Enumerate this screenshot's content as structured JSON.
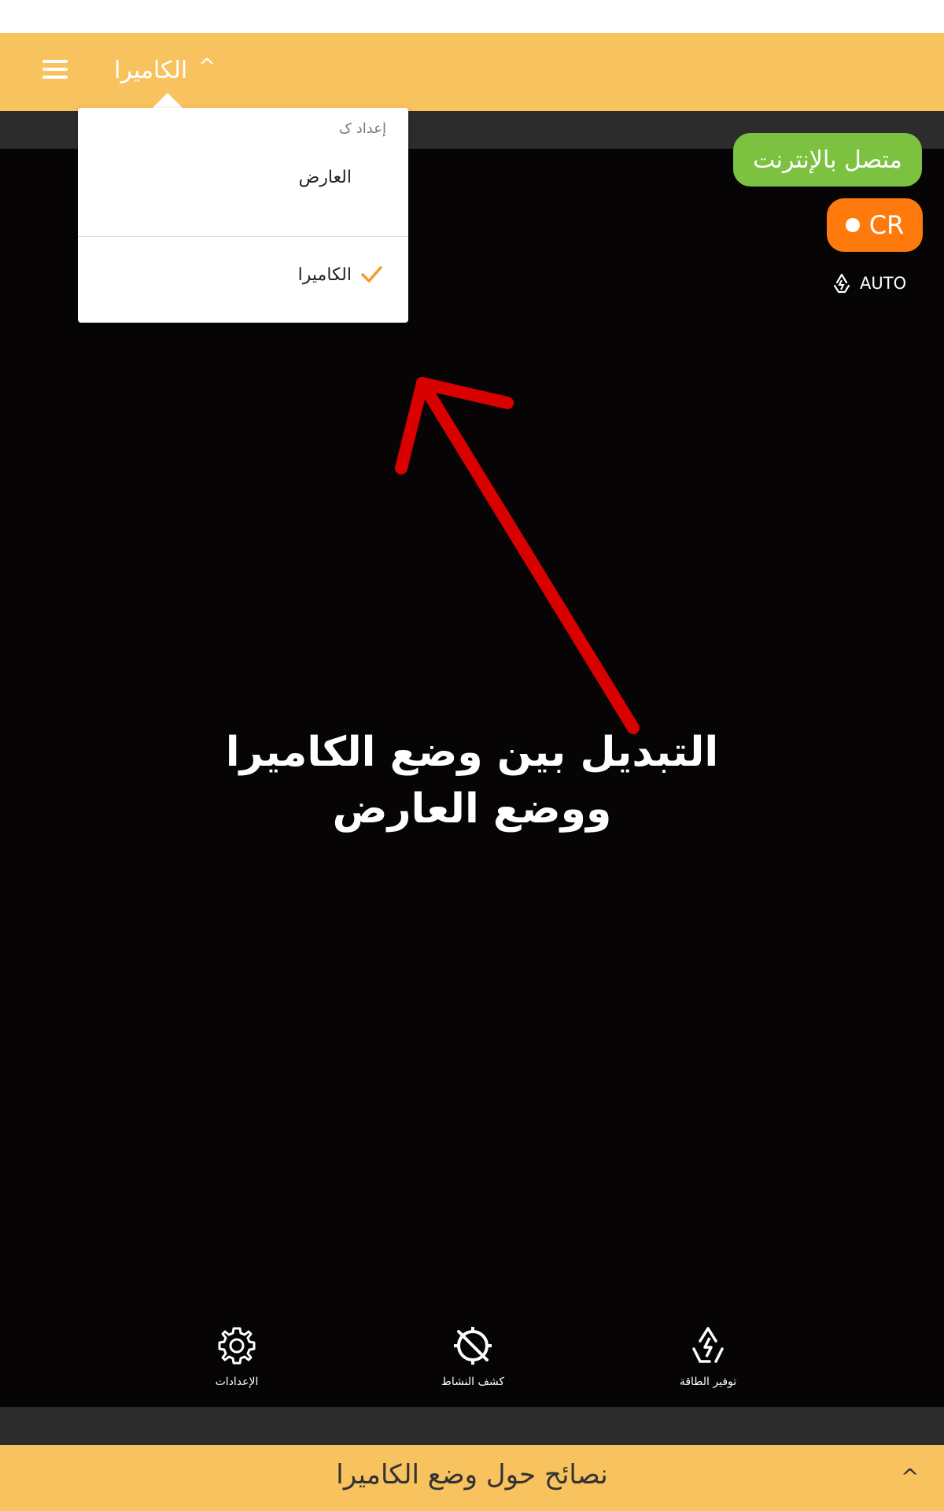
{
  "app": {
    "mode_title": "الكاميرا"
  },
  "header": {
    "menu_icon": "hamburger-menu-icon",
    "dropdown_caret_icon": "chevron-up-icon"
  },
  "mode_dropdown": {
    "header_label": "إعداد ک",
    "options": [
      {
        "label": "العارض",
        "selected": false
      },
      {
        "label": "الكاميرا",
        "selected": true
      }
    ],
    "check_color": "#f39c2b"
  },
  "status": {
    "online_label": "متصل بالإنترنت",
    "online_color": "#7dc141",
    "record_label": "CR",
    "record_color": "#ff7a0d",
    "auto_label": "AUTO",
    "auto_icon": "recycle-power-icon"
  },
  "annotation": {
    "line1": "التبديل بين وضع الكاميرا",
    "line2": "ووضع العارض",
    "arrow_color": "#d90000"
  },
  "bottom_nav": [
    {
      "label": "الإعدادات",
      "icon": "gear-icon"
    },
    {
      "label": "كشف النشاط",
      "icon": "motion-detection-off-icon"
    },
    {
      "label": "توفير الطاقة",
      "icon": "power-saving-icon"
    }
  ],
  "tips": {
    "title": "نصائح حول وضع الكاميرا",
    "chevron_icon": "chevron-up-icon"
  },
  "colors": {
    "header_bg": "#f8c25e",
    "camera_bg": "#060404",
    "strip_bg": "#2c2c2c"
  }
}
